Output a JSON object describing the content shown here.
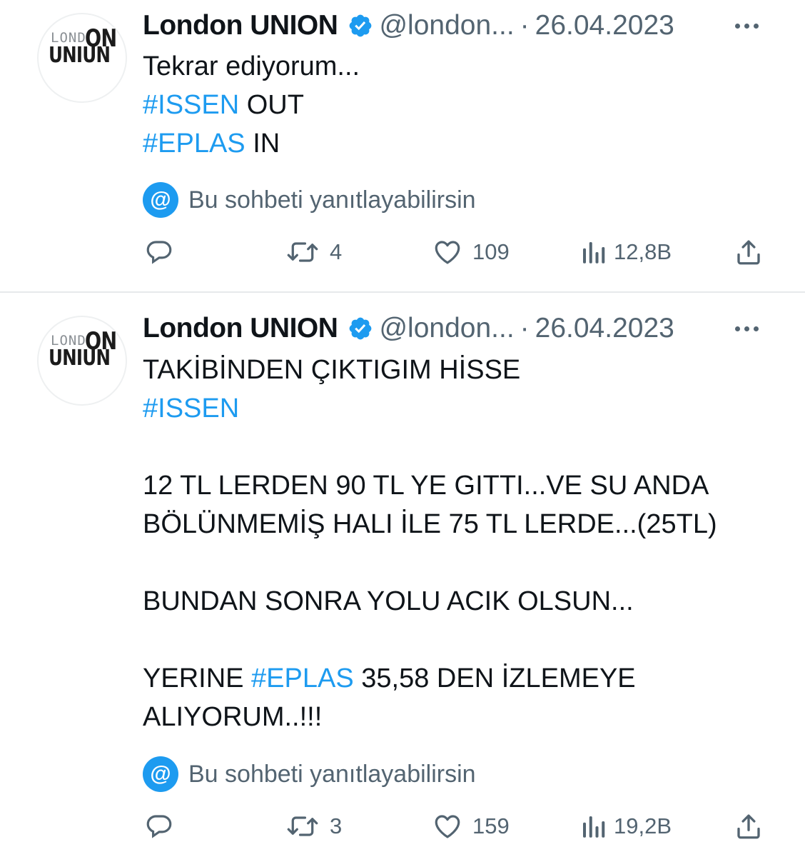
{
  "tweets": [
    {
      "author_name": "London UNION",
      "handle": "@london...",
      "separator": "·",
      "date": "26.04.2023",
      "avatar_logo": {
        "top": "LOND",
        "on": "ON",
        "main": "UNIUN"
      },
      "lines": [
        [
          {
            "text": "Tekrar ediyorum...",
            "hashtag": false
          }
        ],
        [
          {
            "text": "#ISSEN",
            "hashtag": true
          },
          {
            "text": " OUT",
            "hashtag": false
          }
        ],
        [
          {
            "text": "#EPLAS",
            "hashtag": true
          },
          {
            "text": " IN",
            "hashtag": false
          }
        ]
      ],
      "reply_prompt": "Bu sohbeti yanıtlayabilirsin",
      "reply_badge": "@",
      "actions": {
        "reply": "",
        "retweets": "4",
        "likes": "109",
        "views": "12,8B"
      }
    },
    {
      "author_name": "London UNION",
      "handle": "@london...",
      "separator": "·",
      "date": "26.04.2023",
      "avatar_logo": {
        "top": "LOND",
        "on": "ON",
        "main": "UNIUN"
      },
      "lines": [
        [
          {
            "text": "TAKİBİNDEN ÇIKTIGIM HİSSE",
            "hashtag": false
          }
        ],
        [
          {
            "text": "#ISSEN",
            "hashtag": true
          }
        ],
        [],
        [
          {
            "text": "12 TL LERDEN 90 TL YE GITTI...VE SU ANDA",
            "hashtag": false
          }
        ],
        [
          {
            "text": "BÖLÜNMEMİŞ HALI İLE 75 TL LERDE...(25TL)",
            "hashtag": false
          }
        ],
        [],
        [
          {
            "text": "BUNDAN SONRA YOLU ACIK OLSUN...",
            "hashtag": false
          }
        ],
        [],
        [
          {
            "text": "YERINE ",
            "hashtag": false
          },
          {
            "text": "#EPLAS",
            "hashtag": true
          },
          {
            "text": " 35,58 DEN İZLEMEYE",
            "hashtag": false
          }
        ],
        [
          {
            "text": "ALIYORUM..!!!",
            "hashtag": false
          }
        ]
      ],
      "reply_prompt": "Bu sohbeti yanıtlayabilirsin",
      "reply_badge": "@",
      "actions": {
        "reply": "",
        "retweets": "3",
        "likes": "159",
        "views": "19,2B"
      }
    }
  ],
  "colors": {
    "hashtag": "#1d9bf0",
    "verified": "#1d9bf0",
    "secondary_text": "#536471",
    "primary_text": "#0f1419",
    "divider": "#e6e9eb"
  }
}
